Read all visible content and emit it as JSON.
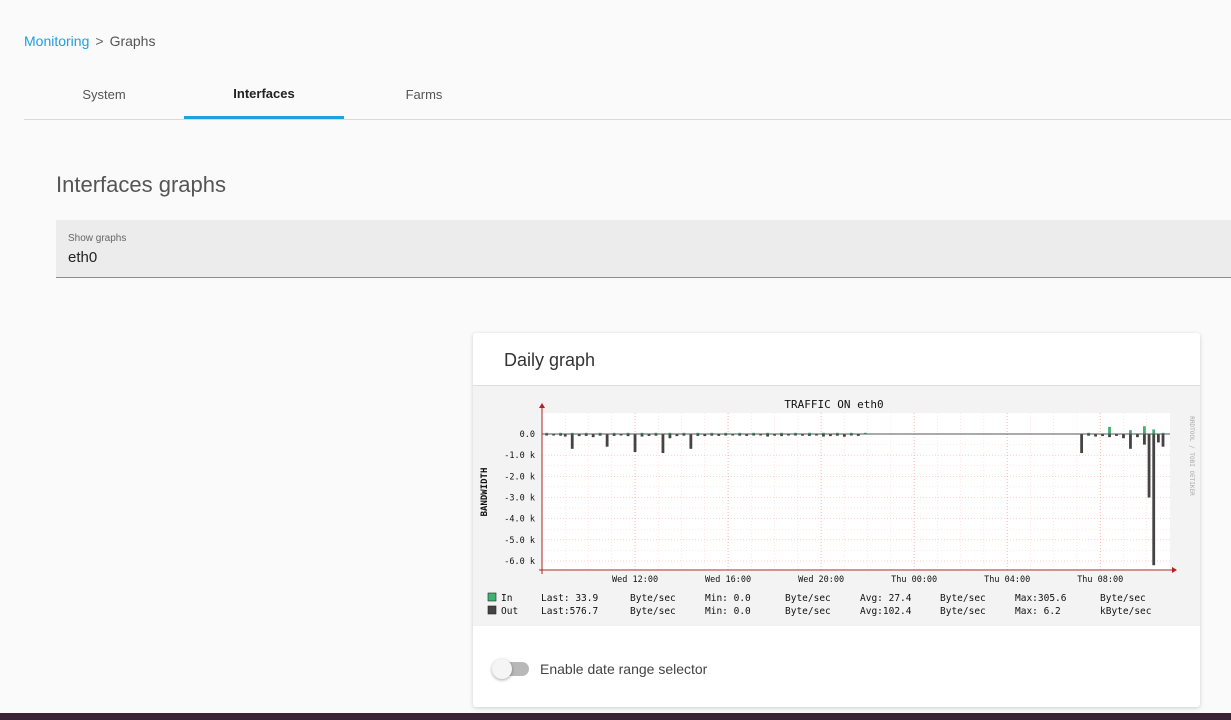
{
  "breadcrumb": {
    "root": "Monitoring",
    "separator": ">",
    "current": "Graphs"
  },
  "tabs": [
    {
      "label": "System",
      "active": false
    },
    {
      "label": "Interfaces",
      "active": true
    },
    {
      "label": "Farms",
      "active": false
    }
  ],
  "page": {
    "title": "Interfaces graphs"
  },
  "select": {
    "label": "Show graphs",
    "value": "eth0"
  },
  "card": {
    "title": "Daily graph",
    "toggle_label": "Enable date range selector",
    "toggle_enabled": false
  },
  "colors": {
    "accent": "#1ea1dc",
    "in_series": "#3cb371",
    "out_series": "#444444",
    "grid": "#ff9999"
  },
  "chart_data": {
    "type": "area",
    "title": "TRAFFIC ON eth0",
    "ylabel": "BANDWIDTH",
    "side_label": "RRDTOOL / TOBI OETIKER",
    "y_ticks": [
      "0.0",
      "-1.0 k",
      "-2.0 k",
      "-3.0 k",
      "-4.0 k",
      "-5.0 k",
      "-6.0 k"
    ],
    "x_ticks": [
      "Wed 12:00",
      "Wed 16:00",
      "Wed 20:00",
      "Thu 00:00",
      "Thu 04:00",
      "Thu 08:00"
    ],
    "ylim": [
      -6000,
      0
    ],
    "legend": [
      {
        "name": "In",
        "last": "Last: 33.9",
        "unit1": "Byte/sec",
        "min": "Min:  0.0",
        "unit2": "Byte/sec",
        "avg": "Avg: 27.4",
        "unit3": "Byte/sec",
        "max": "Max:305.6",
        "unit4": "Byte/sec"
      },
      {
        "name": "Out",
        "last": "Last:576.7",
        "unit1": "Byte/sec",
        "min": "Min:  0.0",
        "unit2": "Byte/sec",
        "avg": "Avg:102.4",
        "unit3": "Byte/sec",
        "max": "Max:  6.2",
        "unit4": "kByte/sec"
      }
    ],
    "series": [
      {
        "name": "Out",
        "x_hours": [
          8.2,
          8.5,
          8.8,
          9.0,
          9.3,
          9.6,
          9.9,
          10.2,
          10.5,
          10.8,
          11.1,
          11.4,
          11.7,
          12.0,
          12.3,
          12.6,
          12.9,
          13.2,
          13.5,
          13.8,
          14.1,
          14.4,
          14.7,
          15.0,
          15.3,
          15.6,
          15.9,
          16.2,
          16.5,
          16.8,
          17.1,
          17.4,
          17.7,
          18.0,
          18.3,
          18.6,
          18.9,
          19.2,
          19.5,
          19.8,
          20.1,
          20.4,
          20.7,
          21.0,
          21.3,
          21.6,
          21.9,
          22.2,
          22.5,
          22.8,
          23.1,
          23.4,
          23.7,
          24.0,
          24.3,
          24.6,
          24.9,
          25.2,
          25.5,
          25.8,
          26.1,
          26.4,
          26.7,
          27.0,
          27.3,
          27.6,
          27.9,
          28.2,
          28.5,
          28.8,
          29.1,
          29.4,
          29.7,
          30.0,
          30.3,
          30.6,
          30.9,
          31.2,
          31.5,
          31.8,
          32.1,
          32.4,
          32.7,
          33.0,
          33.3,
          33.6,
          33.9,
          34.1,
          34.3,
          34.5,
          34.7
        ],
        "values": [
          -50,
          -60,
          -80,
          -120,
          -700,
          -100,
          -90,
          -150,
          -80,
          -600,
          -90,
          -60,
          -100,
          -850,
          -120,
          -90,
          -80,
          -900,
          -200,
          -100,
          -80,
          -700,
          -90,
          -100,
          -80,
          -90,
          -60,
          -70,
          -80,
          -90,
          -60,
          -70,
          -120,
          -80,
          -100,
          -60,
          -70,
          -80,
          -90,
          -60,
          -120,
          -100,
          -80,
          -130,
          -70,
          -90,
          0,
          0,
          0,
          0,
          0,
          0,
          0,
          0,
          0,
          0,
          0,
          0,
          0,
          0,
          0,
          0,
          0,
          0,
          0,
          0,
          0,
          0,
          0,
          0,
          0,
          0,
          0,
          0,
          0,
          0,
          0,
          -900,
          -80,
          -120,
          -100,
          -150,
          -90,
          -200,
          -700,
          -150,
          -500,
          -3000,
          -6200,
          -400,
          -600
        ]
      },
      {
        "name": "In",
        "x_hours": [
          8.2,
          8.8,
          9.3,
          9.9,
          10.5,
          11.1,
          11.7,
          12.3,
          12.9,
          13.5,
          14.1,
          14.7,
          15.3,
          15.9,
          16.5,
          17.1,
          17.7,
          18.3,
          18.9,
          19.5,
          20.1,
          20.7,
          21.3,
          21.9,
          31.5,
          32.4,
          33.3,
          33.9,
          34.3,
          34.7
        ],
        "values": [
          30,
          25,
          40,
          30,
          35,
          28,
          30,
          33,
          28,
          30,
          29,
          25,
          30,
          31,
          27,
          28,
          30,
          29,
          30,
          25,
          30,
          28,
          27,
          30,
          33,
          280,
          150,
          305.6,
          180,
          33.9
        ]
      }
    ]
  }
}
